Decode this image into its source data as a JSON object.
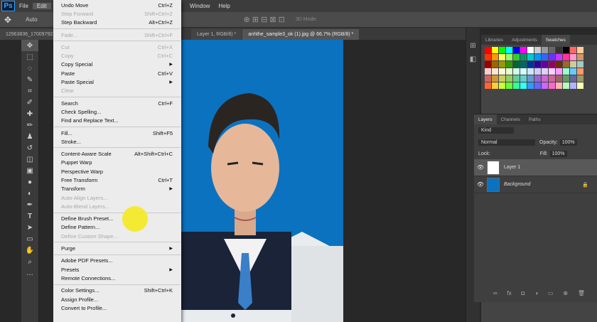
{
  "menubar": {
    "logo": "Ps",
    "items": [
      "File",
      "Edit",
      "Image",
      "Layer",
      "Type",
      "Select",
      "Filter",
      "3D",
      "View",
      "Window",
      "Help"
    ]
  },
  "options_bar": {
    "auto_label": "Auto",
    "mode_label": "3D Mode:"
  },
  "doc_tabs": [
    "12963836_17009792...",
    "Layer 1, RGB/8) *",
    "anhthe_sample3_ok (1).jpg @ 66.7% (RGB/8) *"
  ],
  "edit_menu": [
    {
      "label": "Undo Move",
      "shortcut": "Ctrl+Z",
      "disabled": false
    },
    {
      "label": "Step Forward",
      "shortcut": "Shift+Ctrl+Z",
      "disabled": true
    },
    {
      "label": "Step Backward",
      "shortcut": "Alt+Ctrl+Z",
      "disabled": false
    },
    {
      "sep": true
    },
    {
      "label": "Fade...",
      "shortcut": "Shift+Ctrl+F",
      "disabled": true
    },
    {
      "sep": true
    },
    {
      "label": "Cut",
      "shortcut": "Ctrl+X",
      "disabled": true
    },
    {
      "label": "Copy",
      "shortcut": "Ctrl+C",
      "disabled": true
    },
    {
      "label": "Copy Special",
      "shortcut": "",
      "submenu": true,
      "disabled": false
    },
    {
      "label": "Paste",
      "shortcut": "Ctrl+V",
      "disabled": false
    },
    {
      "label": "Paste Special",
      "shortcut": "",
      "submenu": true,
      "disabled": false
    },
    {
      "label": "Clear",
      "shortcut": "",
      "disabled": true
    },
    {
      "sep": true
    },
    {
      "label": "Search",
      "shortcut": "Ctrl+F",
      "disabled": false
    },
    {
      "label": "Check Spelling...",
      "shortcut": "",
      "disabled": false
    },
    {
      "label": "Find and Replace Text...",
      "shortcut": "",
      "disabled": false
    },
    {
      "sep": true
    },
    {
      "label": "Fill...",
      "shortcut": "Shift+F5",
      "disabled": false
    },
    {
      "label": "Stroke...",
      "shortcut": "",
      "disabled": false
    },
    {
      "sep": true
    },
    {
      "label": "Content-Aware Scale",
      "shortcut": "Alt+Shift+Ctrl+C",
      "disabled": false
    },
    {
      "label": "Puppet Warp",
      "shortcut": "",
      "disabled": false
    },
    {
      "label": "Perspective Warp",
      "shortcut": "",
      "disabled": false
    },
    {
      "label": "Free Transform",
      "shortcut": "Ctrl+T",
      "disabled": false
    },
    {
      "label": "Transform",
      "shortcut": "",
      "submenu": true,
      "disabled": false
    },
    {
      "label": "Auto-Align Layers...",
      "shortcut": "",
      "disabled": true
    },
    {
      "label": "Auto-Blend Layers...",
      "shortcut": "",
      "disabled": true
    },
    {
      "sep": true
    },
    {
      "label": "Define Brush Preset...",
      "shortcut": "",
      "disabled": false
    },
    {
      "label": "Define Pattern...",
      "shortcut": "",
      "disabled": false
    },
    {
      "label": "Define Custom Shape...",
      "shortcut": "",
      "disabled": true
    },
    {
      "sep": true
    },
    {
      "label": "Purge",
      "shortcut": "",
      "submenu": true,
      "disabled": false
    },
    {
      "sep": true
    },
    {
      "label": "Adobe PDF Presets...",
      "shortcut": "",
      "disabled": false
    },
    {
      "label": "Presets",
      "shortcut": "",
      "submenu": true,
      "disabled": false
    },
    {
      "label": "Remote Connections...",
      "shortcut": "",
      "disabled": false
    },
    {
      "sep": true
    },
    {
      "label": "Color Settings...",
      "shortcut": "Shift+Ctrl+K",
      "disabled": false
    },
    {
      "label": "Assign Profile...",
      "shortcut": "",
      "disabled": false
    },
    {
      "label": "Convert to Profile...",
      "shortcut": "",
      "disabled": false
    }
  ],
  "panel_tabs_top": [
    "Libraries",
    "Adjustments",
    "Swatches"
  ],
  "swatch_colors": [
    "#ff0000",
    "#ffff00",
    "#00ff00",
    "#00ffff",
    "#0000ff",
    "#ff00ff",
    "#ffffff",
    "#cccccc",
    "#999999",
    "#666666",
    "#333333",
    "#000000",
    "#ff6666",
    "#ffcc99",
    "#ff3300",
    "#ff9900",
    "#ffff66",
    "#99ff66",
    "#33cc33",
    "#009966",
    "#00cccc",
    "#0099ff",
    "#3366ff",
    "#6633ff",
    "#cc33ff",
    "#ff3399",
    "#ff99cc",
    "#cc9966",
    "#990000",
    "#996600",
    "#999900",
    "#339900",
    "#006633",
    "#006666",
    "#003399",
    "#330099",
    "#660099",
    "#990066",
    "#663300",
    "#996633",
    "#cccc99",
    "#99cccc",
    "#ffcccc",
    "#ffe6cc",
    "#ffffcc",
    "#e6ffcc",
    "#ccffe6",
    "#ccffff",
    "#cce6ff",
    "#ccccff",
    "#e6ccff",
    "#ffccff",
    "#ff99ff",
    "#99ffcc",
    "#66ccff",
    "#ff9966",
    "#cc6666",
    "#cc9933",
    "#cccc66",
    "#99cc66",
    "#66cc99",
    "#66cccc",
    "#6699cc",
    "#9966cc",
    "#cc66cc",
    "#cc6699",
    "#996666",
    "#669966",
    "#666699",
    "#999966",
    "#ff6633",
    "#ffcc33",
    "#ccff33",
    "#66ff33",
    "#33ff99",
    "#33ffff",
    "#3399ff",
    "#6666ff",
    "#cc66ff",
    "#ff66cc",
    "#ffb3b3",
    "#b3ffb3",
    "#b3b3ff",
    "#ffffb3"
  ],
  "layers_panel": {
    "tabs": [
      "Layers",
      "Channels",
      "Paths"
    ],
    "kind": "Kind",
    "blend": "Normal",
    "opacity_label": "Opacity:",
    "opacity": "100%",
    "lock_label": "Lock:",
    "fill_label": "Fill:",
    "fill": "100%",
    "layers": [
      {
        "name": "Layer 1",
        "selected": true
      },
      {
        "name": "Background",
        "selected": false
      }
    ]
  }
}
